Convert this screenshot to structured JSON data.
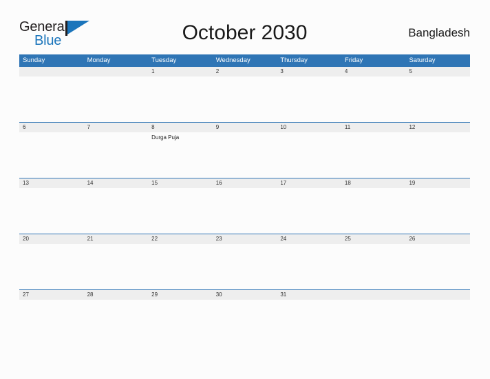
{
  "brand": {
    "name_part1": "General",
    "name_part2": "Blue",
    "primary_color": "#1b75bb",
    "flag_icon": "flag-triangle-icon"
  },
  "header": {
    "title": "October 2030",
    "country": "Bangladesh"
  },
  "calendar": {
    "header_color": "#2f75b5",
    "date_band_color": "#eeeeee",
    "weekdays": [
      "Sunday",
      "Monday",
      "Tuesday",
      "Wednesday",
      "Thursday",
      "Friday",
      "Saturday"
    ],
    "weeks": [
      {
        "days": [
          {
            "date": "",
            "event": ""
          },
          {
            "date": "",
            "event": ""
          },
          {
            "date": "1",
            "event": ""
          },
          {
            "date": "2",
            "event": ""
          },
          {
            "date": "3",
            "event": ""
          },
          {
            "date": "4",
            "event": ""
          },
          {
            "date": "5",
            "event": ""
          }
        ]
      },
      {
        "days": [
          {
            "date": "6",
            "event": ""
          },
          {
            "date": "7",
            "event": ""
          },
          {
            "date": "8",
            "event": "Durga Puja"
          },
          {
            "date": "9",
            "event": ""
          },
          {
            "date": "10",
            "event": ""
          },
          {
            "date": "11",
            "event": ""
          },
          {
            "date": "12",
            "event": ""
          }
        ]
      },
      {
        "days": [
          {
            "date": "13",
            "event": ""
          },
          {
            "date": "14",
            "event": ""
          },
          {
            "date": "15",
            "event": ""
          },
          {
            "date": "16",
            "event": ""
          },
          {
            "date": "17",
            "event": ""
          },
          {
            "date": "18",
            "event": ""
          },
          {
            "date": "19",
            "event": ""
          }
        ]
      },
      {
        "days": [
          {
            "date": "20",
            "event": ""
          },
          {
            "date": "21",
            "event": ""
          },
          {
            "date": "22",
            "event": ""
          },
          {
            "date": "23",
            "event": ""
          },
          {
            "date": "24",
            "event": ""
          },
          {
            "date": "25",
            "event": ""
          },
          {
            "date": "26",
            "event": ""
          }
        ]
      },
      {
        "days": [
          {
            "date": "27",
            "event": ""
          },
          {
            "date": "28",
            "event": ""
          },
          {
            "date": "29",
            "event": ""
          },
          {
            "date": "30",
            "event": ""
          },
          {
            "date": "31",
            "event": ""
          },
          {
            "date": "",
            "event": ""
          },
          {
            "date": "",
            "event": ""
          }
        ]
      }
    ]
  }
}
